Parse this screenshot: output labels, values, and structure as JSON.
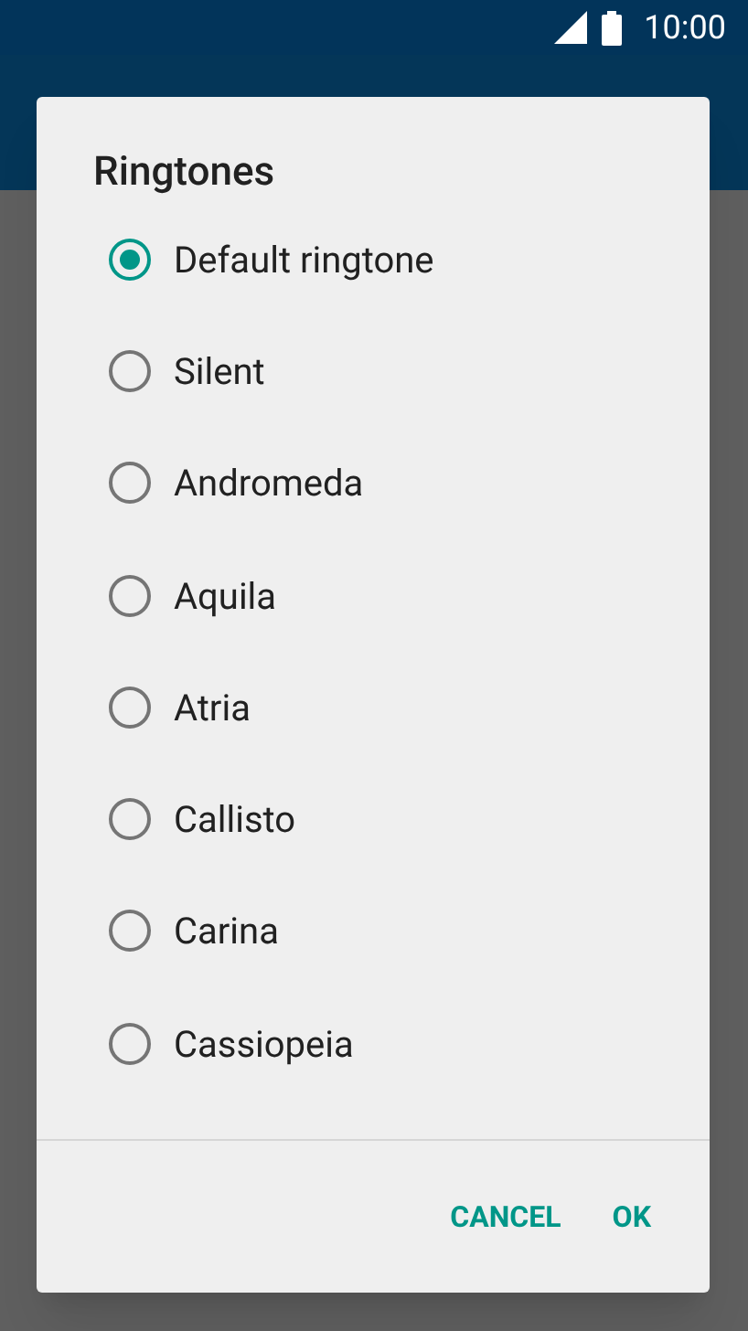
{
  "status_bar": {
    "time": "10:00"
  },
  "dialog": {
    "title": "Ringtones",
    "options": [
      {
        "label": "Default ringtone",
        "selected": true
      },
      {
        "label": "Silent",
        "selected": false
      },
      {
        "label": "Andromeda",
        "selected": false
      },
      {
        "label": "Aquila",
        "selected": false
      },
      {
        "label": "Atria",
        "selected": false
      },
      {
        "label": "Callisto",
        "selected": false
      },
      {
        "label": "Carina",
        "selected": false
      },
      {
        "label": "Cassiopeia",
        "selected": false
      }
    ],
    "buttons": [
      "CANCEL",
      "OK"
    ]
  }
}
